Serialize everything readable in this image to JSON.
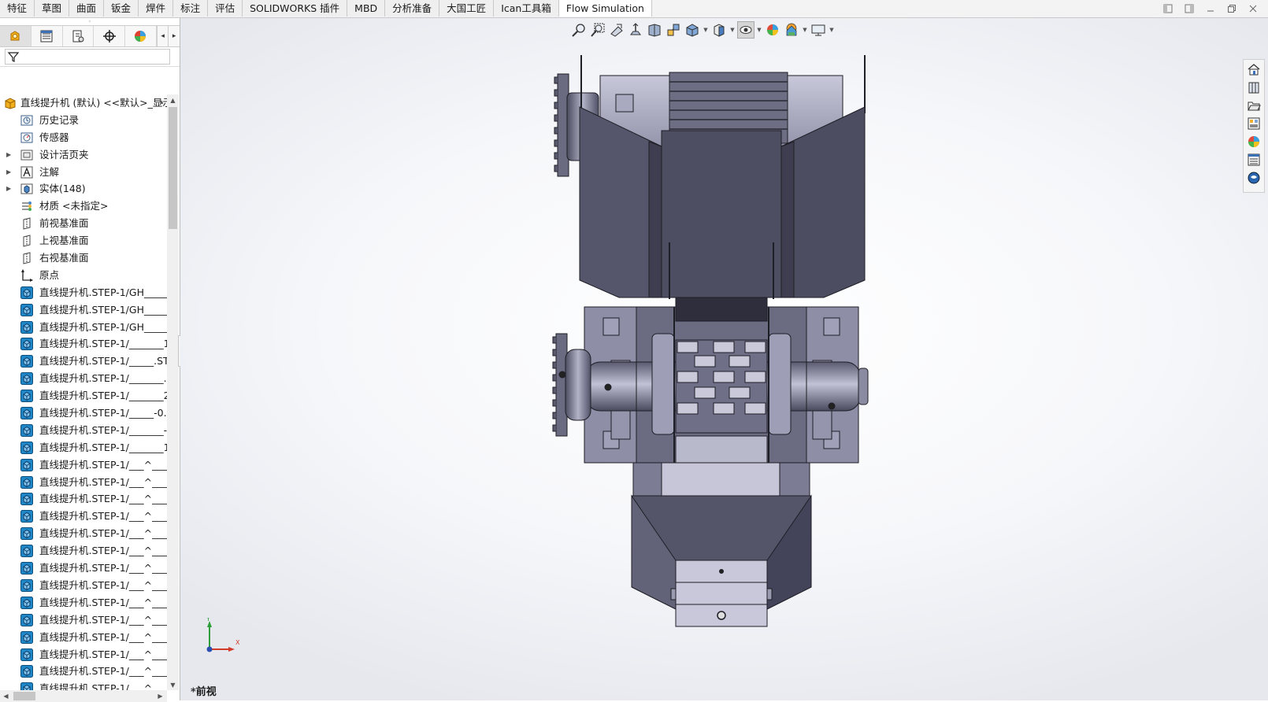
{
  "command_manager": {
    "tabs": [
      {
        "label": "特征"
      },
      {
        "label": "草图"
      },
      {
        "label": "曲面"
      },
      {
        "label": "钣金"
      },
      {
        "label": "焊件"
      },
      {
        "label": "标注"
      },
      {
        "label": "评估"
      },
      {
        "label": "SOLIDWORKS 插件"
      },
      {
        "label": "MBD"
      },
      {
        "label": "分析准备"
      },
      {
        "label": "大国工匠"
      },
      {
        "label": "Ican工具箱"
      },
      {
        "label": "Flow Simulation"
      }
    ],
    "active_tab": "Flow Simulation"
  },
  "window_controls": [
    "tile-left-icon",
    "tile-right-icon",
    "minimize-icon",
    "restore-icon",
    "close-icon"
  ],
  "feature_manager": {
    "panel_tabs": [
      "featuremanager-icon",
      "propertymanager-icon",
      "configurationmanager-icon",
      "dimxpert-icon",
      "display-manager-icon"
    ],
    "root": {
      "label": "直线提升机 (默认) <<默认>_显示状"
    },
    "items": [
      {
        "label": "历史记录",
        "icon": "history-icon",
        "expandable": false
      },
      {
        "label": "传感器",
        "icon": "sensor-icon",
        "expandable": false
      },
      {
        "label": "设计活页夹",
        "icon": "design-binder-icon",
        "expandable": true
      },
      {
        "label": "注解",
        "icon": "annotations-icon",
        "expandable": true
      },
      {
        "label": "实体(148)",
        "icon": "solid-bodies-icon",
        "expandable": true
      },
      {
        "label": "材质 <未指定>",
        "icon": "material-icon",
        "expandable": false
      },
      {
        "label": "前视基准面",
        "icon": "plane-icon",
        "expandable": false
      },
      {
        "label": "上视基准面",
        "icon": "plane-icon",
        "expandable": false
      },
      {
        "label": "右视基准面",
        "icon": "plane-icon",
        "expandable": false
      },
      {
        "label": "原点",
        "icon": "origin-icon",
        "expandable": false
      },
      {
        "label": "直线提升机.STEP-1/GH_____",
        "icon": "body-icon",
        "expandable": false
      },
      {
        "label": "直线提升机.STEP-1/GH_____",
        "icon": "body-icon",
        "expandable": false
      },
      {
        "label": "直线提升机.STEP-1/GH_____",
        "icon": "body-icon",
        "expandable": false
      },
      {
        "label": "直线提升机.STEP-1/_______1",
        "icon": "body-icon",
        "expandable": false
      },
      {
        "label": "直线提升机.STEP-1/_____.STE",
        "icon": "body-icon",
        "expandable": false
      },
      {
        "label": "直线提升机.STEP-1/_______.",
        "icon": "body-icon",
        "expandable": false
      },
      {
        "label": "直线提升机.STEP-1/_______2",
        "icon": "body-icon",
        "expandable": false
      },
      {
        "label": "直线提升机.STEP-1/_____-0.S",
        "icon": "body-icon",
        "expandable": false
      },
      {
        "label": "直线提升机.STEP-1/_______-",
        "icon": "body-icon",
        "expandable": false
      },
      {
        "label": "直线提升机.STEP-1/_______1",
        "icon": "body-icon",
        "expandable": false
      },
      {
        "label": "直线提升机.STEP-1/___^___",
        "icon": "body-icon",
        "expandable": false
      },
      {
        "label": "直线提升机.STEP-1/___^___",
        "icon": "body-icon",
        "expandable": false
      },
      {
        "label": "直线提升机.STEP-1/___^___",
        "icon": "body-icon",
        "expandable": false
      },
      {
        "label": "直线提升机.STEP-1/___^___",
        "icon": "body-icon",
        "expandable": false
      },
      {
        "label": "直线提升机.STEP-1/___^___",
        "icon": "body-icon",
        "expandable": false
      },
      {
        "label": "直线提升机.STEP-1/___^___",
        "icon": "body-icon",
        "expandable": false
      },
      {
        "label": "直线提升机.STEP-1/___^___",
        "icon": "body-icon",
        "expandable": false
      },
      {
        "label": "直线提升机.STEP-1/___^___",
        "icon": "body-icon",
        "expandable": false
      },
      {
        "label": "直线提升机.STEP-1/___^___",
        "icon": "body-icon",
        "expandable": false
      },
      {
        "label": "直线提升机.STEP-1/___^___",
        "icon": "body-icon",
        "expandable": false
      },
      {
        "label": "直线提升机.STEP-1/___^___",
        "icon": "body-icon",
        "expandable": false
      },
      {
        "label": "直线提升机.STEP-1/___^___",
        "icon": "body-icon",
        "expandable": false
      },
      {
        "label": "直线提升机.STEP-1/___^___",
        "icon": "body-icon",
        "expandable": false
      },
      {
        "label": "直线提升机.STEP-1/___^___",
        "icon": "body-icon",
        "expandable": false
      }
    ]
  },
  "heads_up_toolbar": [
    "zoom-to-fit-icon",
    "zoom-to-area-icon",
    "previous-view-icon",
    "section-view-icon",
    "dynamic-annotation-icon",
    "view-orientation-icon",
    "display-style-icon",
    "hide-show-items-icon",
    "edit-appearance-icon",
    "apply-scene-icon",
    "view-settings-icon"
  ],
  "task_pane": [
    "home-icon",
    "design-library-icon",
    "file-explorer-icon",
    "view-palette-icon",
    "appearances-icon",
    "custom-properties-icon",
    "solidworks-forum-icon"
  ],
  "viewport": {
    "view_name": "*前视",
    "triad": {
      "x": "X",
      "y": "Y"
    },
    "colors": {
      "model_light": "#9b9bb3",
      "model_mid": "#6e6e86",
      "model_dark": "#4c4c5e",
      "edge": "#1e1e26"
    }
  }
}
